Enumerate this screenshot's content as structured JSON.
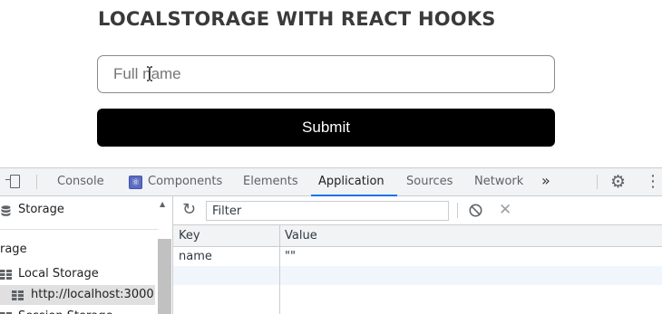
{
  "app": {
    "title": "LOCALSTORAGE WITH REACT HOOKS",
    "name_input": {
      "placeholder": "Full name",
      "value": ""
    },
    "submit_label": "Submit"
  },
  "devtools": {
    "tabs": [
      {
        "label": "Console"
      },
      {
        "label": "Components"
      },
      {
        "label": "Elements"
      },
      {
        "label": "Application",
        "active": true
      },
      {
        "label": "Sources"
      },
      {
        "label": "Network"
      }
    ],
    "more_tabs_label": "»",
    "sidebar": {
      "storage_header": "Storage",
      "section_partial": "rage",
      "local_storage": "Local Storage",
      "origin": "http://localhost:3000",
      "session_storage_partial": "Session Storage"
    },
    "toolbar": {
      "filter_placeholder": "Filter"
    },
    "table": {
      "columns": [
        "Key",
        "Value"
      ],
      "rows": [
        {
          "key": "name",
          "value": "\"\""
        }
      ]
    },
    "colors": {
      "accent": "#1a73e8",
      "submit_bg": "#000000"
    }
  }
}
